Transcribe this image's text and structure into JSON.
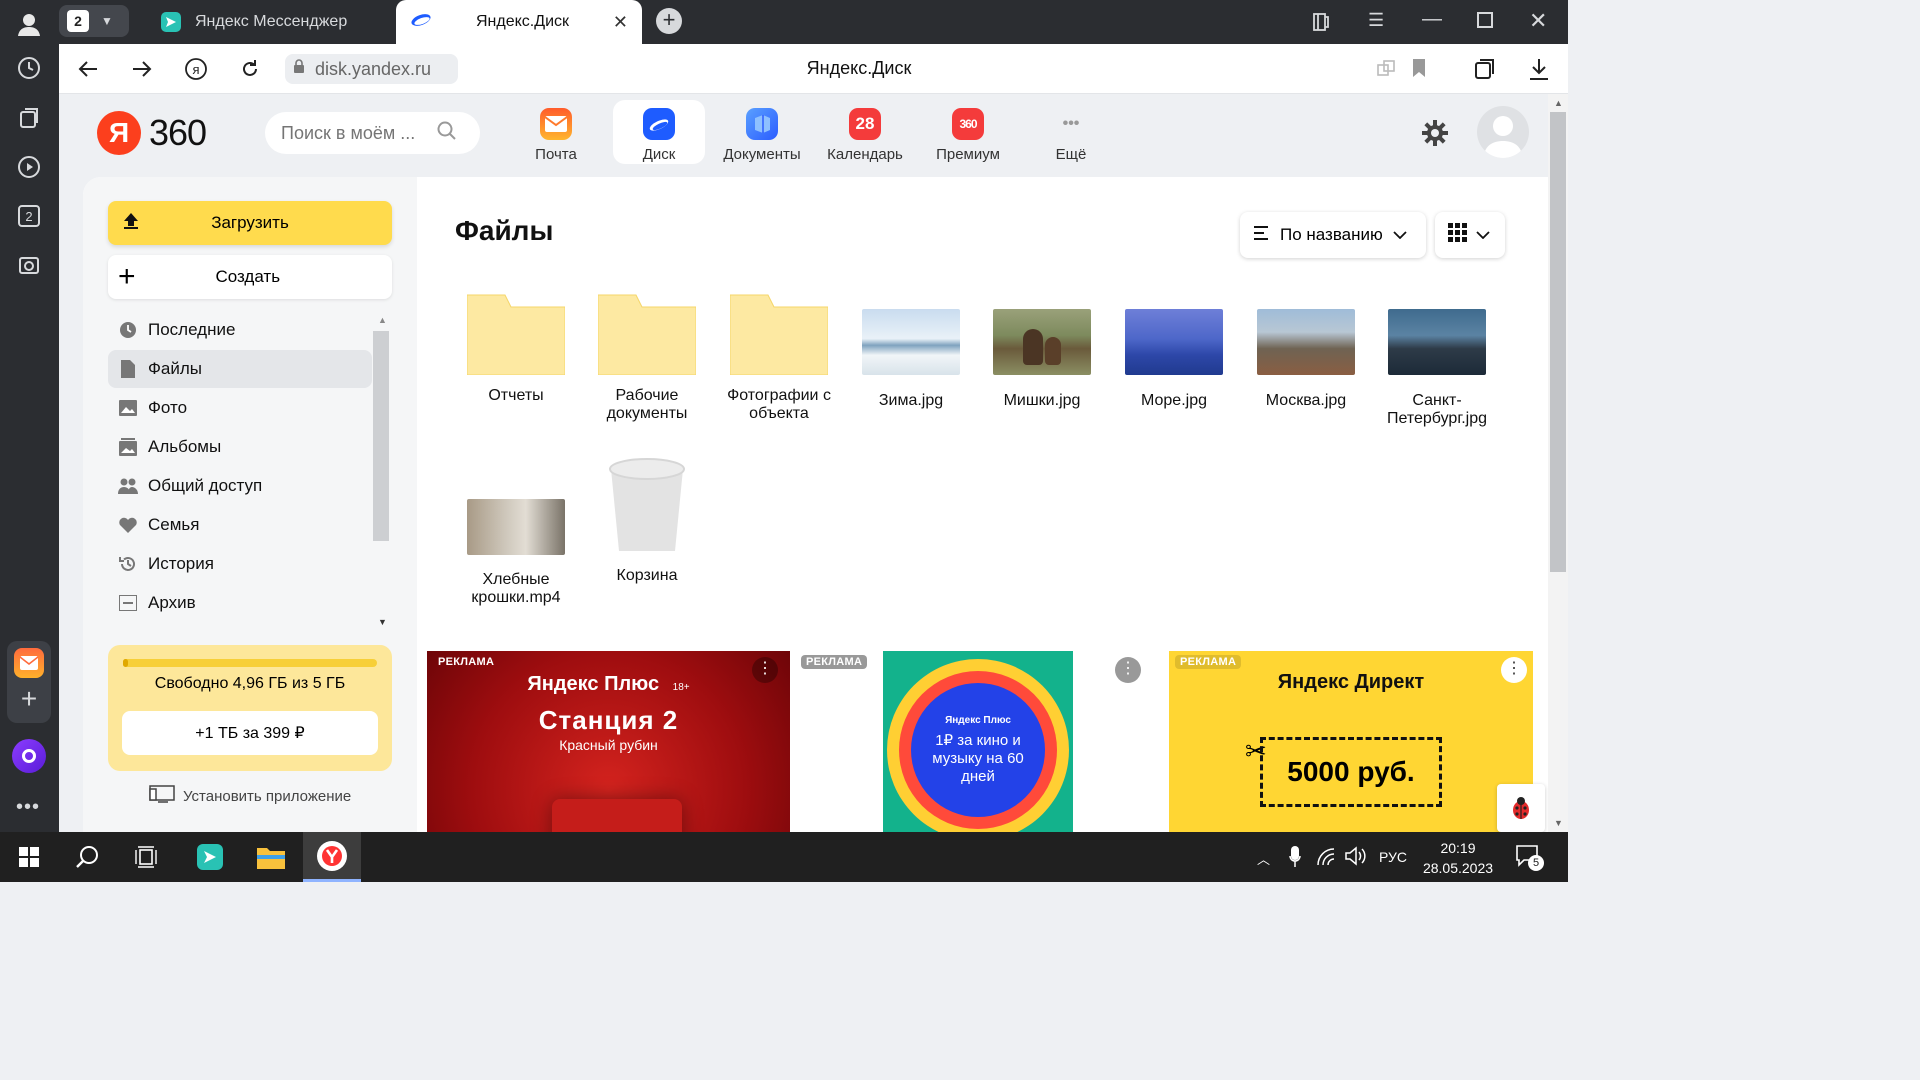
{
  "browser": {
    "tab_count": "2",
    "tabs": [
      {
        "title": "Яндекс Мессенджер"
      },
      {
        "title": "Яндекс.Диск"
      }
    ],
    "address": "disk.yandex.ru",
    "page_title": "Яндекс.Диск",
    "sidebar_badge": "2"
  },
  "header": {
    "logo_ya": "Я",
    "logo_360": "360",
    "search_placeholder": "Поиск в моём ...",
    "services": [
      {
        "label": "Почта",
        "icon": "mail-icon"
      },
      {
        "label": "Диск",
        "icon": "disk-icon",
        "active": true
      },
      {
        "label": "Документы",
        "icon": "documents-icon"
      },
      {
        "label": "Календарь",
        "icon": "calendar-icon",
        "badge": "28"
      },
      {
        "label": "Премиум",
        "icon": "premium-icon",
        "badge": "360"
      },
      {
        "label": "Ещё",
        "icon": "more-icon"
      }
    ]
  },
  "sidebar": {
    "upload_label": "Загрузить",
    "create_label": "Создать",
    "items": [
      {
        "label": "Последние"
      },
      {
        "label": "Файлы",
        "active": true
      },
      {
        "label": "Фото"
      },
      {
        "label": "Альбомы"
      },
      {
        "label": "Общий доступ"
      },
      {
        "label": "Семья"
      },
      {
        "label": "История"
      },
      {
        "label": "Архив"
      }
    ],
    "storage": {
      "text": "Свободно 4,96 ГБ из 5 ГБ",
      "used_fraction": 0.008,
      "upgrade_label": "+1 ТБ за 399 ₽"
    },
    "install_app": "Установить приложение"
  },
  "main": {
    "title": "Файлы",
    "sort_label": "По названию",
    "files": [
      {
        "name": "Отчеты",
        "type": "folder"
      },
      {
        "name": "Рабочие документы",
        "type": "folder"
      },
      {
        "name": "Фотографии с объекта",
        "type": "folder"
      },
      {
        "name": "Зима.jpg",
        "type": "image"
      },
      {
        "name": "Мишки.jpg",
        "type": "image"
      },
      {
        "name": "Море.jpg",
        "type": "image"
      },
      {
        "name": "Москва.jpg",
        "type": "image"
      },
      {
        "name": "Санкт-Петербург.jpg",
        "type": "image"
      },
      {
        "name": "Хлебные крошки.mp4",
        "type": "video"
      },
      {
        "name": "Корзина",
        "type": "trash"
      }
    ]
  },
  "ads": [
    {
      "label": "РЕКЛАМА",
      "brand": "Яндекс Плюс",
      "age": "18+",
      "title": "Станция 2",
      "subtitle": "Красный рубин"
    },
    {
      "label": "РЕКЛАМА",
      "brand": "Яндекс Плюс",
      "text": "1₽ за кино и музыку на 60 дней"
    },
    {
      "label": "РЕКЛАМА",
      "brand": "Яндекс Директ",
      "text": "5000 руб."
    }
  ],
  "taskbar": {
    "lang": "РУС",
    "time": "20:19",
    "date": "28.05.2023",
    "notifications": "5"
  },
  "colors": {
    "accent_yellow": "#ffdb4d",
    "logo_red": "#fc3f1d",
    "active_item": "#e4e6e9"
  }
}
